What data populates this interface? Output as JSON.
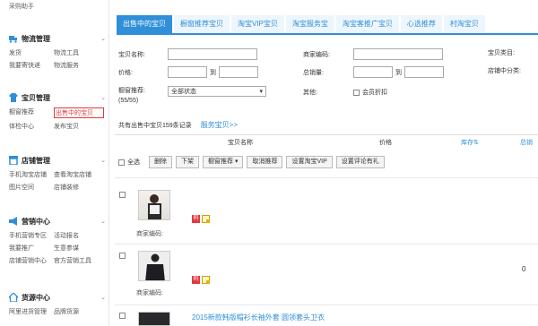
{
  "sidebar": {
    "top_link": "采购助手",
    "sections": [
      {
        "title": "物流管理",
        "icon": "truck-icon",
        "links": [
          "发货",
          "物流工具",
          "我要寄快递",
          "物流服务"
        ]
      },
      {
        "title": "宝贝管理",
        "icon": "shirt-icon",
        "links": [
          "橱窗推荐",
          "出售中的宝贝",
          "体检中心",
          "发布宝贝"
        ],
        "active": "出售中的宝贝"
      },
      {
        "title": "店铺管理",
        "icon": "store-icon",
        "links": [
          "手机淘宝店铺",
          "查看淘宝店铺",
          "图片空间",
          "店铺装修"
        ]
      },
      {
        "title": "营销中心",
        "icon": "megaphone-icon",
        "links": [
          "手机营销专区",
          "活动报名",
          "我要推广",
          "生意参谋",
          "店铺营销中心",
          "官方营销工具"
        ]
      },
      {
        "title": "货源中心",
        "icon": "home-icon",
        "links": [
          "阿里进货管理",
          "品牌货源"
        ]
      }
    ]
  },
  "tabs": [
    "出售中的宝贝",
    "橱窗推荐宝贝",
    "淘宝VIP宝贝",
    "淘宝服务宝",
    "淘宝客推广宝贝",
    "心选推荐",
    "村淘宝贝"
  ],
  "active_tab": "出售中的宝贝",
  "form": {
    "name_label": "宝贝名称:",
    "merchant_code_label": "商家编码:",
    "category_label": "宝贝类目:",
    "price_label": "价格:",
    "to": "到",
    "sales_label": "总销量:",
    "shop_category_label": "店铺中分类:",
    "window_label": "橱窗推荐:",
    "window_count": "(55/55)",
    "status_value": "全部状态",
    "other_label": "其他:",
    "member_discount": "会员折扣"
  },
  "summary": {
    "text": "共有出售中宝贝159条记录",
    "service_link": "服务宝贝>>"
  },
  "table_header": {
    "name": "宝贝名称",
    "price": "价格",
    "stock": "库存",
    "sales": "总销"
  },
  "toolbar": {
    "select_all": "全选",
    "buttons": [
      "删除",
      "下架",
      "橱窗推荐",
      "取消推荐",
      "设置淘宝VIP",
      "设置评论有礼"
    ]
  },
  "rows": [
    {
      "code_label": "商家编码:",
      "price": "",
      "sales": ""
    },
    {
      "code_label": "商家编码:",
      "price": "",
      "sales": "0"
    },
    {
      "title": "2015新款韩版帽衫长袖外套 圆领套头卫衣"
    }
  ],
  "colors": {
    "accent": "#2f8fd8",
    "active_border": "#e4393c"
  }
}
